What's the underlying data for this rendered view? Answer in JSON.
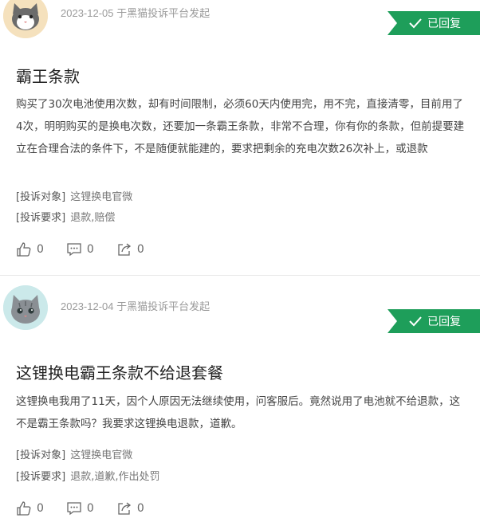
{
  "posts": [
    {
      "meta": "2023-12-05 于黑猫投诉平台发起",
      "badge": "已回复",
      "title": "霸王条款",
      "content": "购买了30次电池使用次数，却有时间限制，必须60天内使用完，用不完，直接清零，目前用了4次，明明购买的是换电次数，还要加一条霸王条款，非常不合理，你有你的条款，但前提要建立在合理合法的条件下，不是随便就能建的，要求把剩余的充电次数26次补上，或退款",
      "target_label": "[投诉对象]",
      "target_value": "这锂换电官微",
      "demand_label": "[投诉要求]",
      "demand_value": "退款,赔偿",
      "likes": "0",
      "comments": "0",
      "shares": "0"
    },
    {
      "meta": "2023-12-04 于黑猫投诉平台发起",
      "badge": "已回复",
      "title": "这锂换电霸王条款不给退套餐",
      "content": "这锂换电我用了11天，因个人原因无法继续使用，问客服后。竟然说用了电池就不给退款，这不是霸王条款吗？我要求这锂换电退款，道歉。",
      "target_label": "[投诉对象]",
      "target_value": "这锂换电官微",
      "demand_label": "[投诉要求]",
      "demand_value": "退款,道歉,作出处罚",
      "likes": "0",
      "comments": "0",
      "shares": "0"
    }
  ],
  "icons": {
    "avatar1": "orange-cat-avatar",
    "avatar2": "gray-cat-avatar",
    "badge": "check-icon",
    "like": "thumbs-up-icon",
    "comment": "comment-icon",
    "share": "share-icon"
  },
  "colors": {
    "badge_bg": "#1e9e5a",
    "meta_text": "#9a9a9a"
  }
}
